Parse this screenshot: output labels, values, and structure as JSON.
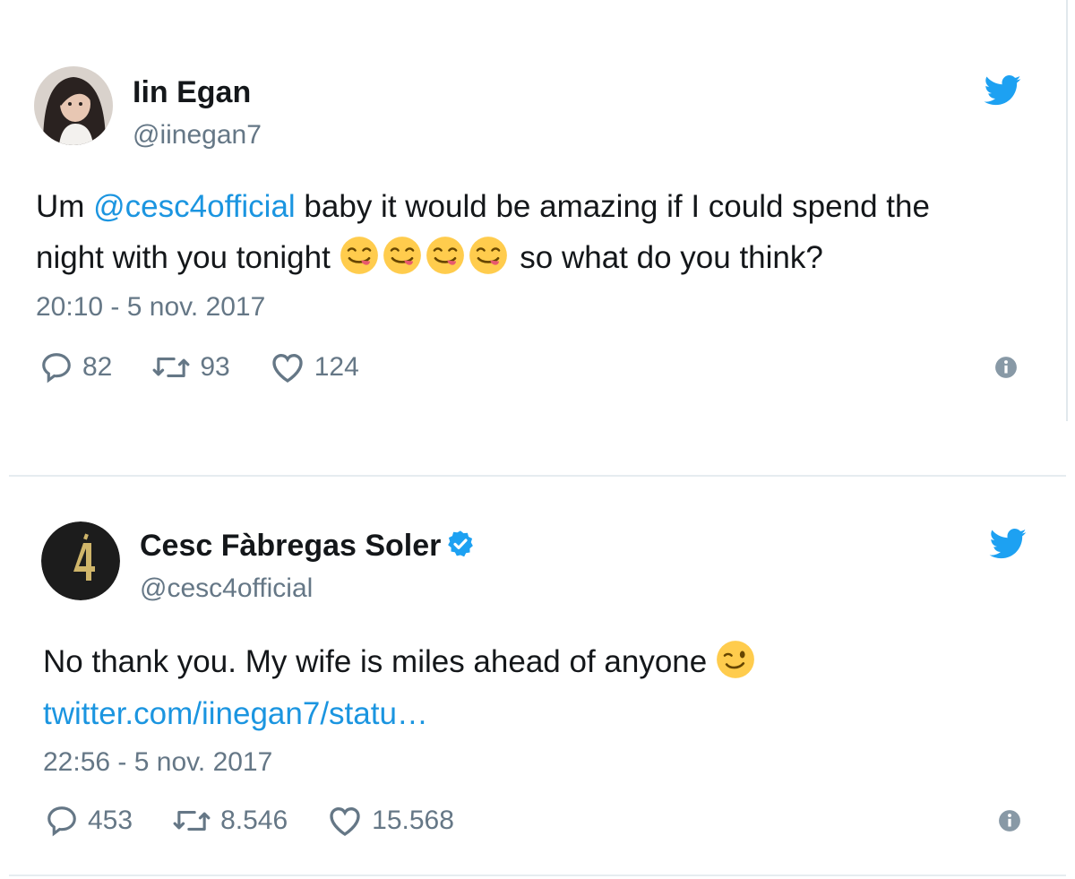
{
  "tweets": [
    {
      "author_name": "Iin Egan",
      "handle": "@iinegan7",
      "text_prefix": "Um ",
      "mention": "@cesc4official",
      "text_line1_rest": " baby it would be amazing if I could spend the",
      "text_line2_start": "night with you tonight ",
      "emojis": [
        "yum-emoji",
        "yum-emoji",
        "yum-emoji",
        "yum-emoji"
      ],
      "text_line2_end": " so what do you think?",
      "timestamp": "20:10 - 5 nov. 2017",
      "replies": "82",
      "retweets": "93",
      "likes": "124"
    },
    {
      "author_name": "Cesc Fàbregas Soler",
      "verified": true,
      "handle": "@cesc4official",
      "text": "No thank you. My wife is miles ahead of anyone ",
      "emoji": "wink-emoji",
      "link": "twitter.com/iinegan7/statu…",
      "timestamp": "22:56 - 5 nov. 2017",
      "replies": "453",
      "retweets": "8.546",
      "likes": "15.568"
    }
  ],
  "colors": {
    "twitter_blue": "#1da1f2",
    "link_blue": "#1b95e0",
    "secondary_text": "#657786",
    "primary_text": "#14171a"
  }
}
